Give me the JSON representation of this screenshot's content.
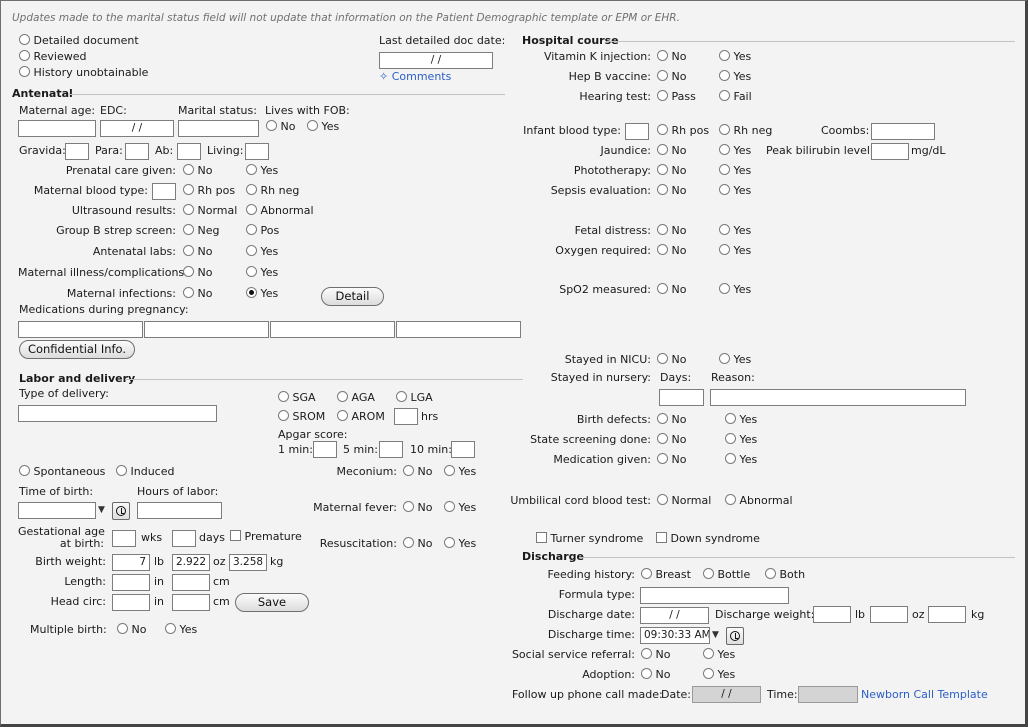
{
  "notice": "Updates made to the marital status field will not update that information on the Patient Demographic template or EPM or EHR.",
  "top": {
    "detailed": "Detailed document",
    "reviewed": "Reviewed",
    "history": "History unobtainable",
    "last_doc_label": "Last detailed doc date:",
    "last_doc_value": "/ /",
    "comments": "Comments"
  },
  "antenatal": {
    "title": "Antenatal",
    "maternal_age": "Maternal age:",
    "edc": "EDC:",
    "edc_value": "/ /",
    "marital": "Marital status:",
    "lives_fob": "Lives with FOB:",
    "gravida": "Gravida:",
    "para": "Para:",
    "ab": "Ab:",
    "living": "Living:",
    "prenatal": "Prenatal care given:",
    "blood_type": "Maternal blood type:",
    "ultrasound": "Ultrasound results:",
    "gbs": "Group B strep screen:",
    "labs": "Antenatal labs:",
    "illness": "Maternal illness/complications:",
    "infections": "Maternal infections:",
    "detail": "Detail",
    "meds": "Medications during pregnancy:",
    "confidential": "Confidential Info."
  },
  "opts": {
    "no": "No",
    "yes": "Yes",
    "rhpos": "Rh pos",
    "rhneg": "Rh neg",
    "normal": "Normal",
    "abnormal": "Abnormal",
    "neg": "Neg",
    "pos": "Pos",
    "pass": "Pass",
    "fail": "Fail",
    "normal2": "Normal",
    "abnormal2": "Abnormal"
  },
  "labor": {
    "title": "Labor and delivery",
    "type": "Type of delivery:",
    "sga": "SGA",
    "aga": "AGA",
    "lga": "LGA",
    "srom": "SROM",
    "arom": "AROM",
    "hrs": "hrs",
    "apgar": "Apgar score:",
    "min1": "1 min:",
    "min5": "5 min:",
    "min10": "10 min:",
    "spont": "Spontaneous",
    "induced": "Induced",
    "meconium": "Meconium:",
    "time_birth": "Time of birth:",
    "hours_labor": "Hours of labor:",
    "fever": "Maternal fever:",
    "gest1": "Gestational age",
    "gest2": "at birth:",
    "wks": "wks",
    "days": "days",
    "premature": "Premature",
    "resus": "Resuscitation:",
    "weight": "Birth weight:",
    "lb_val": "7",
    "lb": "lb",
    "oz_val": "2.922",
    "oz": "oz",
    "kg_val": "3.258",
    "kg": "kg",
    "length": "Length:",
    "in": "in",
    "cm": "cm",
    "head": "Head circ:",
    "save": "Save",
    "multiple": "Multiple birth:"
  },
  "hospital": {
    "title": "Hospital course",
    "vitk": "Vitamin K injection:",
    "hepb": "Hep B vaccine:",
    "hearing": "Hearing test:",
    "infant_bt": "Infant blood type:",
    "coombs": "Coombs:",
    "jaundice": "Jaundice:",
    "peak": "Peak bilirubin level:",
    "mgdl": "mg/dL",
    "photo": "Phototherapy:",
    "sepsis": "Sepsis evaluation:",
    "fetal": "Fetal distress:",
    "oxygen": "Oxygen required:",
    "spo2": "SpO2 measured:",
    "nicu": "Stayed in NICU:",
    "nursery": "Stayed in nursery:",
    "days": "Days:",
    "reason": "Reason:",
    "defects": "Birth defects:",
    "screening": "State screening done:",
    "medgiven": "Medication given:",
    "cord": "Umbilical cord blood test:",
    "turner": "Turner syndrome",
    "down": "Down syndrome"
  },
  "discharge": {
    "title": "Discharge",
    "feeding": "Feeding history:",
    "breast": "Breast",
    "bottle": "Bottle",
    "both": "Both",
    "formula": "Formula type:",
    "date": "Discharge date:",
    "date_value": "/ /",
    "weight": "Discharge weight:",
    "lb": "lb",
    "oz": "oz",
    "kg": "kg",
    "time": "Discharge time:",
    "time_value": "09:30:33 AM",
    "social": "Social service referral:",
    "adoption": "Adoption:",
    "followup": "Follow up phone call made:",
    "date_lbl": "Date:",
    "fu_date": "/ /",
    "time_lbl": "Time:",
    "template": "Newborn Call Template"
  }
}
